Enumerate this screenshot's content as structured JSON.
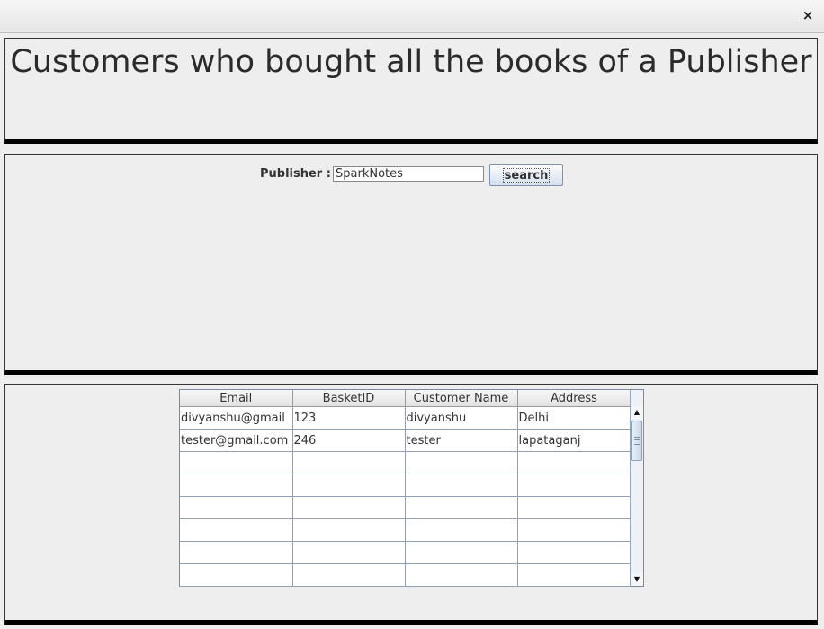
{
  "window": {
    "close_label": "×"
  },
  "header": {
    "title": "Customers who bought all the books of a Publisher"
  },
  "search": {
    "label": "Publisher :",
    "value": "SparkNotes",
    "button_label": "search"
  },
  "table": {
    "columns": [
      "Email",
      "BasketID",
      "Customer Name",
      "Address"
    ],
    "rows": [
      [
        "divyanshu@gmail",
        "123",
        "divyanshu",
        "Delhi"
      ],
      [
        "tester@gmail.com",
        "246",
        "tester",
        "lapataganj"
      ],
      [
        "",
        "",
        "",
        ""
      ],
      [
        "",
        "",
        "",
        ""
      ],
      [
        "",
        "",
        "",
        ""
      ],
      [
        "",
        "",
        "",
        ""
      ],
      [
        "",
        "",
        "",
        ""
      ],
      [
        "",
        "",
        "",
        ""
      ]
    ],
    "scroll_up_icon": "triangle-up",
    "scroll_down_icon": "triangle-down"
  }
}
